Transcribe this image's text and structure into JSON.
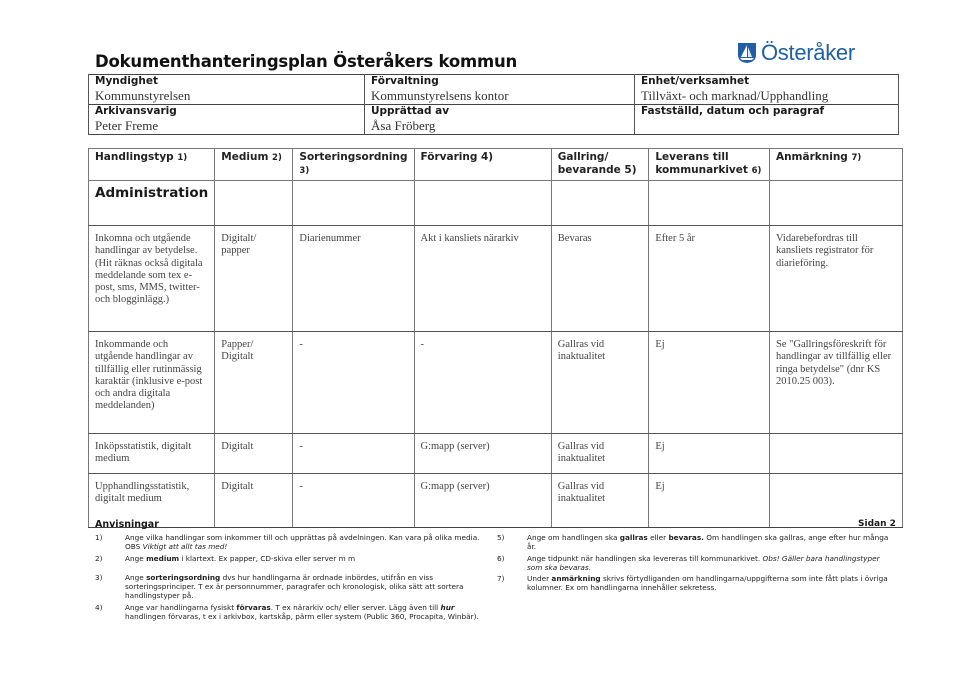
{
  "document": {
    "title": "Dokumenthanteringsplan Österåkers kommun",
    "logo_text": "Österåker",
    "logo_icon": "shield-sailboat-icon",
    "brand_color": "#1f5fa8",
    "page_label": "Sidan 2"
  },
  "meta": {
    "myndighet_label": "Myndighet",
    "myndighet_value": "Kommunstyrelsen",
    "forvaltning_label": "Förvaltning",
    "forvaltning_value": "Kommunstyrelsens kontor",
    "enhet_label": "Enhet/verksamhet",
    "enhet_value": "Tillväxt- och marknad/Upphandling",
    "arkivansvarig_label": "Arkivansvarig",
    "arkivansvarig_value": "Peter Freme",
    "upprattad_label": "Upprättad av",
    "upprattad_value": "Åsa Fröberg",
    "faststalld_label": "Fastställd, datum och paragraf",
    "faststalld_value": ""
  },
  "table": {
    "headers": [
      {
        "label": "Handlingstyp",
        "note": "1)"
      },
      {
        "label": "Medium",
        "note": "2)"
      },
      {
        "label": "Sorteringsordning",
        "note": "3)"
      },
      {
        "label": "Förvaring",
        "note": "4)"
      },
      {
        "label": "Gallring/ bevarande",
        "note": "5)"
      },
      {
        "label": "Leverans till kommunarkivet",
        "note": "6)"
      },
      {
        "label": "Anmärkning",
        "note": "7)"
      }
    ],
    "section_title": "Administration",
    "rows": [
      {
        "handlingstyp": "Inkomna och utgående handlingar av betydelse. (Hit räknas också digitala meddelande som tex e-post, sms, MMS, twitter- och blogginlägg.)",
        "medium": "Digitalt/ papper",
        "sortering": "Diarienummer",
        "forvaring": "Akt i kansliets närarkiv",
        "gallring": "Bevaras",
        "leverans": "Efter 5 år",
        "anmarkning": "Vidarebefordras till kansliets registrator för diarieföring."
      },
      {
        "handlingstyp": "Inkommande och utgående handlingar av tillfällig eller rutinmässig karaktär (inklusive e-post och andra digitala meddelanden)",
        "medium": "Papper/ Digitalt",
        "sortering": "-",
        "forvaring": "-",
        "gallring": "Gallras vid inaktualitet",
        "leverans": "Ej",
        "anmarkning": "Se \"Gallringsföreskrift för handlingar av tillfällig eller ringa betydelse\" (dnr KS 2010.25  003)."
      },
      {
        "handlingstyp": "Inköpsstatistik, digitalt medium",
        "medium": "Digitalt",
        "sortering": "-",
        "forvaring": "G:mapp (server)",
        "gallring": "Gallras vid inaktualitet",
        "leverans": "Ej",
        "anmarkning": ""
      },
      {
        "handlingstyp": "Upphandlingsstatistik, digitalt medium",
        "medium": "Digitalt",
        "sortering": "-",
        "forvaring": "G:mapp (server)",
        "gallring": "Gallras vid inaktualitet",
        "leverans": "Ej",
        "anmarkning": ""
      }
    ]
  },
  "instructions": {
    "heading": "Anvisningar",
    "items": [
      {
        "num": "1)",
        "parts": [
          {
            "t": "Ange vilka handlingar som inkommer till och upprättas på avdelningen. Kan vara på olika media. OBS "
          },
          {
            "t": "Viktigt att allt tas med!",
            "style": "italic"
          }
        ]
      },
      {
        "num": "2)",
        "parts": [
          {
            "t": "Ange "
          },
          {
            "t": "medium",
            "style": "bold"
          },
          {
            "t": " i klartext. Ex papper, CD-skiva eller server m m"
          }
        ]
      },
      {
        "num": "3)",
        "parts": [
          {
            "t": "Ange "
          },
          {
            "t": "sorteringsordning",
            "style": "bold"
          },
          {
            "t": " dvs hur handlingarna är ordnade inbördes, utifrån en viss sorteringsprinciper. T ex är personnummer, paragrafer och kronologisk, olika sätt att sortera handlingstyper på."
          }
        ]
      },
      {
        "num": "4)",
        "parts": [
          {
            "t": "Ange var handlingarna fysiskt "
          },
          {
            "t": "förvaras",
            "style": "bold"
          },
          {
            "t": ". T ex närarkiv och/ eller server. Lägg även till "
          },
          {
            "t": "hur",
            "style": "bolditalic"
          },
          {
            "t": " handlingen förvaras, t ex i arkivbox, kartskåp, pärm eller system (Public 360, Procapita, Winbär)."
          }
        ]
      },
      {
        "num": "5)",
        "parts": [
          {
            "t": "Ange om handlingen ska "
          },
          {
            "t": "gallras",
            "style": "bold"
          },
          {
            "t": " eller "
          },
          {
            "t": "bevaras.",
            "style": "bold"
          },
          {
            "t": " Om handlingen ska gallras, ange efter hur många år."
          }
        ]
      },
      {
        "num": "6)",
        "parts": [
          {
            "t": "Ange tidpunkt när handlingen ska levereras till kommunarkivet. "
          },
          {
            "t": "Obs! Gäller bara handlingstyper som ska bevaras.",
            "style": "italic"
          }
        ]
      },
      {
        "num": "7)",
        "parts": [
          {
            "t": "Under "
          },
          {
            "t": "anmärkning",
            "style": "bold"
          },
          {
            "t": " skrivs förtydliganden om handlingarna/uppgifterna som inte fått plats i övriga kolumner. Ex om handlingarna innehåller sekretess."
          }
        ]
      }
    ]
  }
}
